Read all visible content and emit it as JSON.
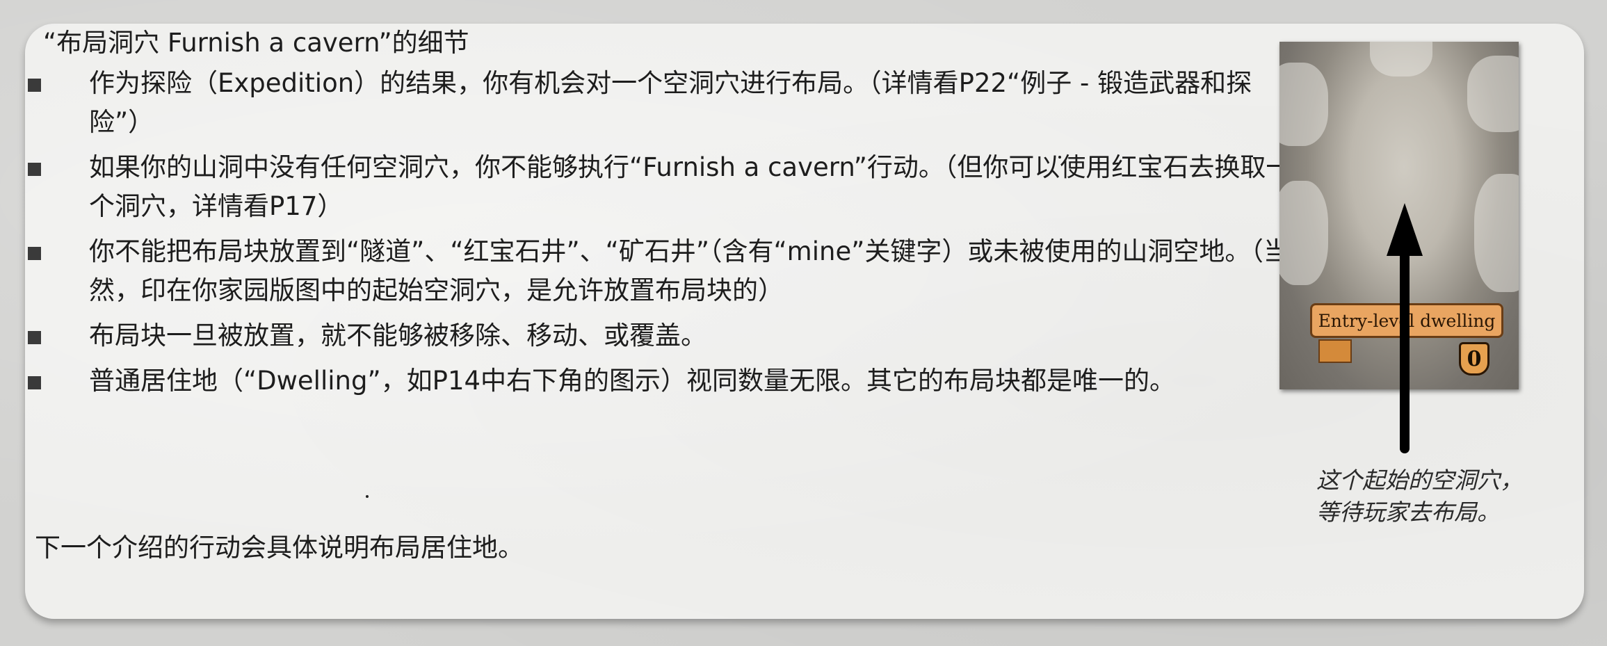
{
  "heading": "“布局洞穴 Furnish a cavern”的细节",
  "rules": [
    "作为探险（Expedition）的结果，你有机会对一个空洞穴进行布局。（详情看P22“例子 - 锻造武器和探险”）",
    "如果你的山洞中没有任何空洞穴，你不能够执行“Furnish a cavern”行动。（但你可以使用红宝石去换取一个洞穴，详情看P17）",
    "你不能把布局块放置到“隧道”、“红宝石井”、“矿石井”（含有“mine”关键字）或未被使用的山洞空地。（当然，印在你家园版图中的起始空洞穴，是允许放置布局块的）",
    "布局块一旦被放置，就不能够被移除、移动、或覆盖。",
    "普通居住地（“Dwelling”，如P14中右下角的图示）视同数量无限。其它的布局块都是唯一的。"
  ],
  "footer": "下一个介绍的行动会具体说明布局居住地。",
  "card": {
    "banner": "Entry-level dwelling",
    "score": "0"
  },
  "caption": {
    "line1": "这个起始的空洞穴，",
    "line2": "等待玩家去布局。"
  },
  "colors": {
    "panel": "#efefed",
    "banner": "#e9a561",
    "arrow": "#000000"
  }
}
